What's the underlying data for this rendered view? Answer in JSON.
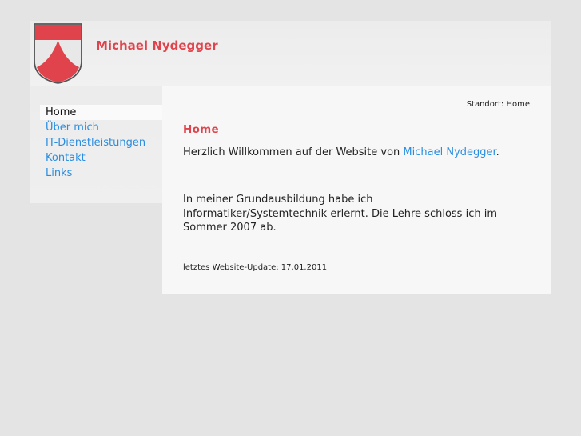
{
  "site": {
    "title": "Michael Nydegger"
  },
  "nav": {
    "items": [
      {
        "label": "Home",
        "active": true
      },
      {
        "label": "Über mich",
        "active": false
      },
      {
        "label": "IT-Dienstleistungen",
        "active": false
      },
      {
        "label": "Kontakt",
        "active": false
      },
      {
        "label": "Links",
        "active": false
      }
    ]
  },
  "breadcrumb": {
    "text": "Standort: Home"
  },
  "content": {
    "heading": "Home",
    "welcome_prefix": "Herzlich Willkommen auf der Website von ",
    "welcome_link": "Michael Nydegger",
    "welcome_suffix": ".",
    "paragraph": "In meiner Grundausbildung habe ich Informatiker/Systemtechnik erlernt. Die Lehre schloss ich im Sommer 2007 ab.",
    "update": "letztes Website-Update: 17.01.2011"
  },
  "colors": {
    "accent": "#e0434b",
    "link": "#2a8ee0",
    "background": "#e4e4e4"
  },
  "icons": {
    "logo": "coat-of-arms-icon"
  }
}
